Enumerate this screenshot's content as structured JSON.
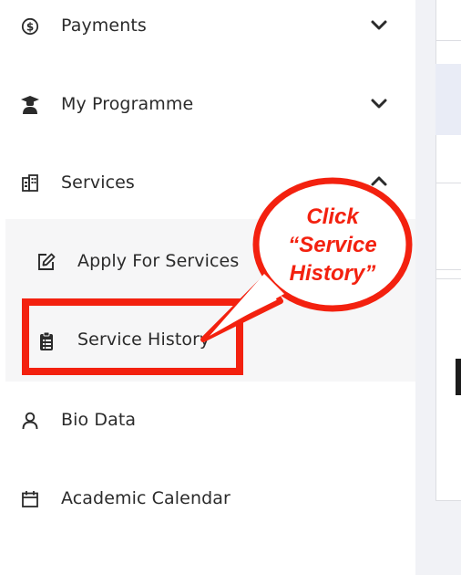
{
  "sidebar": {
    "items": [
      {
        "label": "Payments",
        "icon": "dollar-circle-icon",
        "expanded": false
      },
      {
        "label": "My Programme",
        "icon": "graduate-icon",
        "expanded": false
      },
      {
        "label": "Services",
        "icon": "building-icon",
        "expanded": true
      },
      {
        "label": "Bio Data",
        "icon": "user-icon"
      },
      {
        "label": "Academic Calendar",
        "icon": "calendar-icon"
      }
    ],
    "services_submenu": [
      {
        "label": "Apply For Services",
        "icon": "edit-icon"
      },
      {
        "label": "Service History",
        "icon": "clipboard-icon",
        "highlighted": true
      }
    ]
  },
  "annotation": {
    "line1": "Click",
    "line2": "“Service",
    "line3": "History”",
    "color": "#f3210f"
  }
}
